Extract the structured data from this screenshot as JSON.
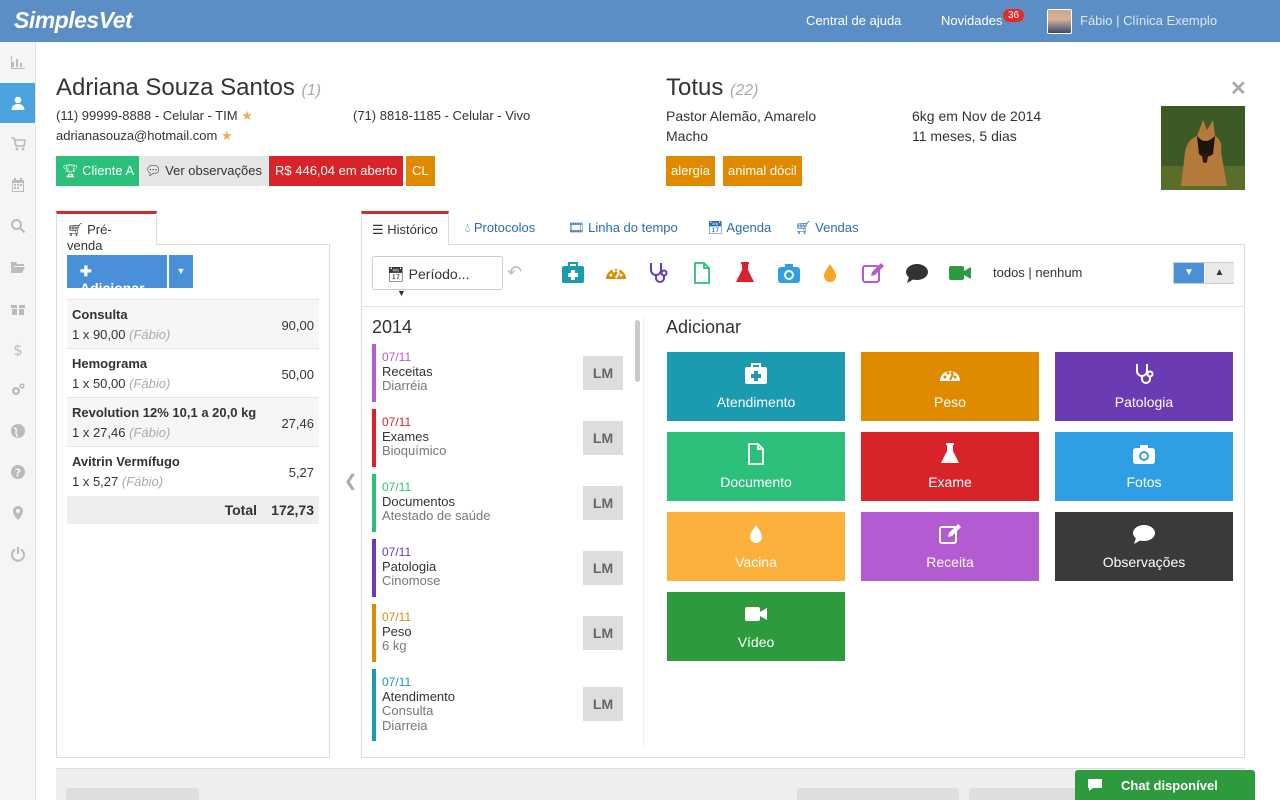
{
  "app": {
    "logo": "SimplesVet"
  },
  "topbar": {
    "help": "Central de ajuda",
    "news": "Novidades",
    "news_count": "36",
    "user": "Fábio | Clínica Exemplo"
  },
  "client": {
    "name": "Adriana Souza Santos",
    "id": "(1)",
    "phone1": "(11) 99999-8888 - Celular - TIM",
    "phone2": "(71) 8818-1185 - Celular - Vivo",
    "email": "adrianasouza@hotmail.com",
    "tags": {
      "class": "Cliente A",
      "notes": "Ver observações",
      "debt": "R$ 446,04 em aberto",
      "cl": "CL"
    }
  },
  "pet": {
    "name": "Totus",
    "id": "(22)",
    "breed": "Pastor Alemão, Amarelo",
    "sex": "Macho",
    "weight": "6kg em Nov de 2014",
    "age": "11 meses, 5 dias",
    "tags": [
      "alergia",
      "animal dócil"
    ]
  },
  "prevenda": {
    "tab": "Pré-venda",
    "add_button": "Adicionar",
    "items": [
      {
        "name": "Consulta",
        "qty": "1 x 90,00",
        "user": "(Fábio)",
        "value": "90,00"
      },
      {
        "name": "Hemograma",
        "qty": "1 x 50,00",
        "user": "(Fábio)",
        "value": "50,00"
      },
      {
        "name": "Revolution 12% 10,1 a 20,0 kg",
        "qty": "1 x 27,46",
        "user": "(Fábio)",
        "value": "27,46"
      },
      {
        "name": "Avitrin Vermífugo",
        "qty": "1 x 5,27",
        "user": "(Fábio)",
        "value": "5,27"
      }
    ],
    "total_label": "Total",
    "total_value": "172,73"
  },
  "tabs": [
    "Histórico",
    "Protocolos",
    "Linha do tempo",
    "Agenda",
    "Vendas"
  ],
  "toolbar": {
    "period": "Período...",
    "filter": "todos | nenhum",
    "icon_colors": [
      "#1a9bb0",
      "#e08a00",
      "#6a3bb3",
      "#2cbf7a",
      "#d9232a",
      "#2f9ee5",
      "#f5a623",
      "#b35bd1",
      "#333333",
      "#2d9a3e"
    ]
  },
  "timeline": {
    "year": "2014",
    "items": [
      {
        "date": "07/11",
        "title": "Receitas",
        "sub": "Diarréia",
        "user": "LM",
        "color": "#b35bd1"
      },
      {
        "date": "07/11",
        "title": "Exames",
        "sub": "Bioquímico",
        "user": "LM",
        "color": "#d9232a"
      },
      {
        "date": "07/11",
        "title": "Documentos",
        "sub": "Atestado de saúde",
        "user": "LM",
        "color": "#2cbf7a"
      },
      {
        "date": "07/11",
        "title": "Patologia",
        "sub": "Cinomose",
        "user": "LM",
        "color": "#6a3bb3"
      },
      {
        "date": "07/11",
        "title": "Peso",
        "sub": "6 kg",
        "user": "LM",
        "color": "#e08a00"
      },
      {
        "date": "07/11",
        "title": "Atendimento",
        "sub": "Consulta",
        "sub2": "Diarreia",
        "user": "LM",
        "color": "#1a9bb0"
      }
    ]
  },
  "add_panel": {
    "title": "Adicionar",
    "tiles": [
      {
        "label": "Atendimento",
        "color": "#1a9bb0",
        "icon": "medkit-icon"
      },
      {
        "label": "Peso",
        "color": "#e08a00",
        "icon": "dashboard-icon"
      },
      {
        "label": "Patologia",
        "color": "#6a3bb3",
        "icon": "stethoscope-icon"
      },
      {
        "label": "Documento",
        "color": "#2cbf7a",
        "icon": "document-icon"
      },
      {
        "label": "Exame",
        "color": "#d9232a",
        "icon": "flask-icon"
      },
      {
        "label": "Fotos",
        "color": "#2f9ee5",
        "icon": "camera-icon"
      },
      {
        "label": "Vacina",
        "color": "#fbb03b",
        "icon": "drop-icon"
      },
      {
        "label": "Receita",
        "color": "#b35bd1",
        "icon": "edit-icon"
      },
      {
        "label": "Observações",
        "color": "#3a3a3a",
        "icon": "comment-icon"
      },
      {
        "label": "Vídeo",
        "color": "#2d9a3e",
        "icon": "video-icon"
      }
    ]
  },
  "chat": {
    "label": "Chat disponível"
  }
}
